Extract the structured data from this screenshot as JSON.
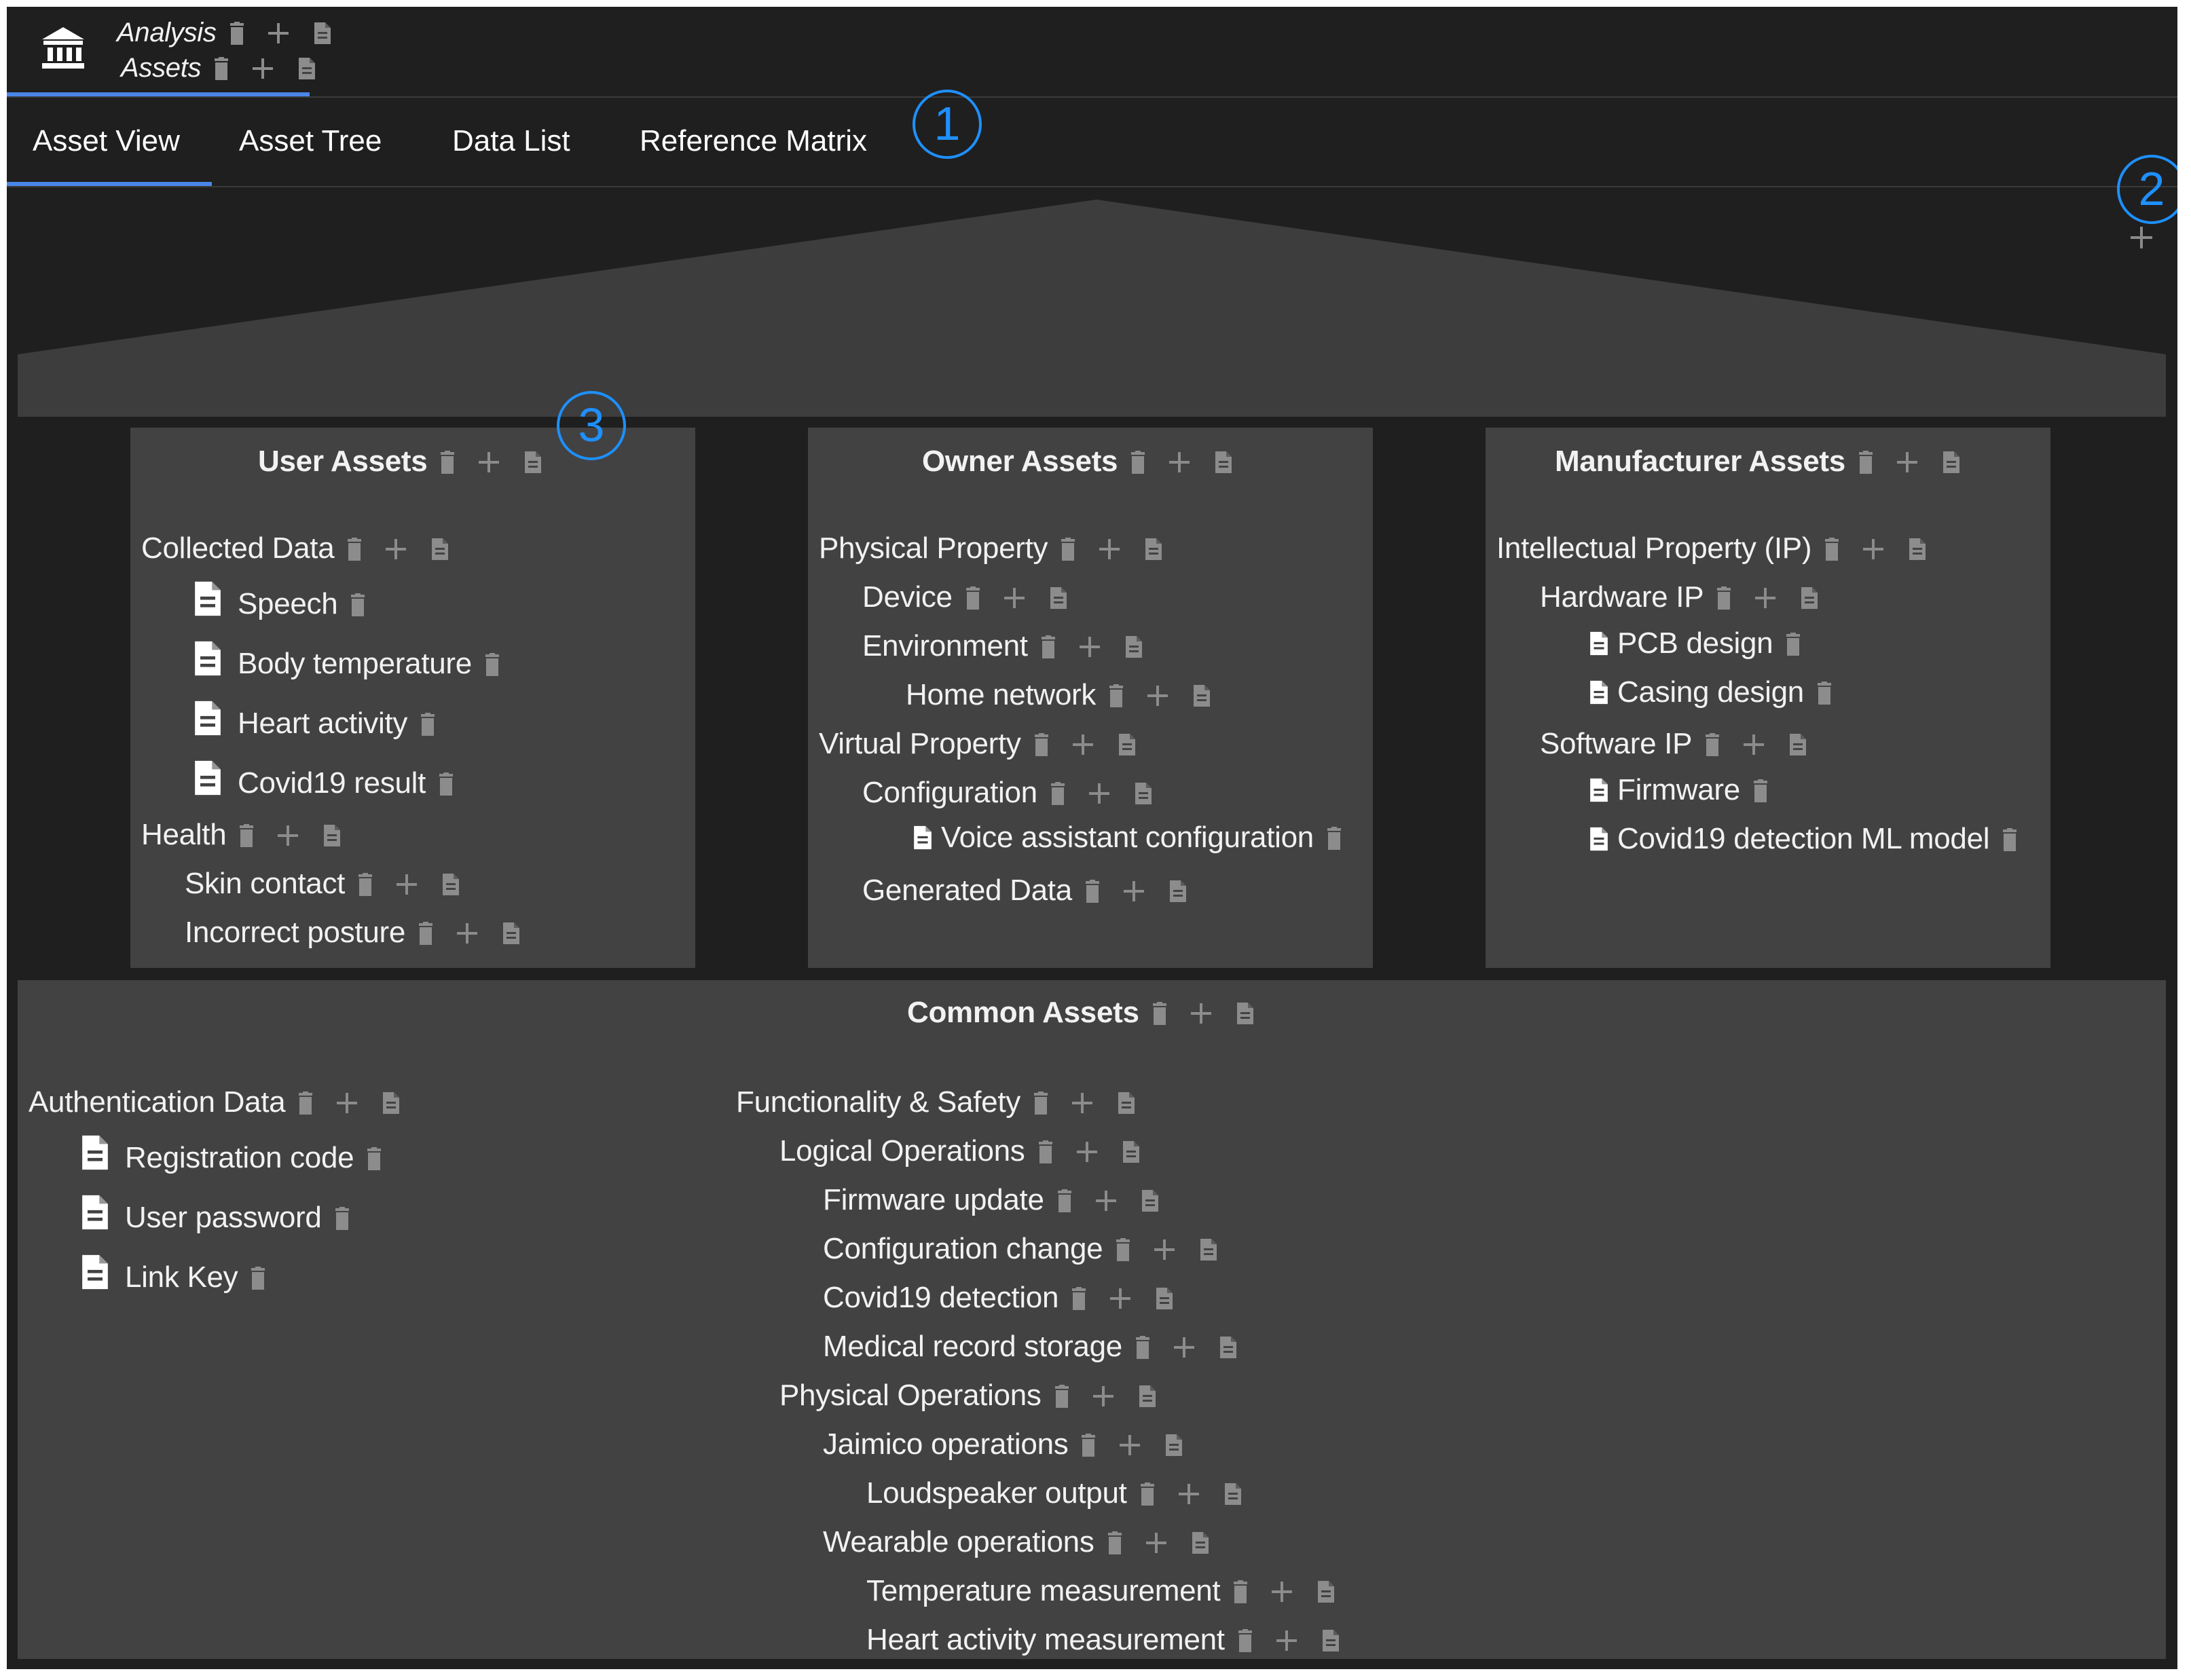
{
  "header": {
    "app_title_line1": "Analysis",
    "app_title_line2": "Assets"
  },
  "tabs": [
    {
      "label": "Asset View",
      "active": true
    },
    {
      "label": "Asset Tree"
    },
    {
      "label": "Data List"
    },
    {
      "label": "Reference Matrix"
    }
  ],
  "callouts": [
    "1",
    "2",
    "3"
  ],
  "colors": {
    "accent": "#4a86e8",
    "callout": "#1e90ff",
    "panel": "#424242",
    "background": "#1f1f1f",
    "roof": "#3d3d3d"
  },
  "user_assets": {
    "title": "User Assets",
    "items": [
      {
        "label": "Collected Data",
        "kind": "group"
      },
      {
        "label": "Speech",
        "kind": "leaf"
      },
      {
        "label": "Body temperature",
        "kind": "leaf"
      },
      {
        "label": "Heart activity",
        "kind": "leaf"
      },
      {
        "label": "Covid19 result",
        "kind": "leaf"
      },
      {
        "label": "Health",
        "kind": "group"
      },
      {
        "label": "Skin contact",
        "kind": "group"
      },
      {
        "label": "Incorrect posture",
        "kind": "group"
      }
    ]
  },
  "owner_assets": {
    "title": "Owner Assets",
    "items": [
      {
        "label": "Physical Property",
        "kind": "group"
      },
      {
        "label": "Device",
        "kind": "group"
      },
      {
        "label": "Environment",
        "kind": "group"
      },
      {
        "label": "Home network",
        "kind": "group"
      },
      {
        "label": "Virtual Property",
        "kind": "group"
      },
      {
        "label": "Configuration",
        "kind": "group"
      },
      {
        "label": "Voice assistant configuration",
        "kind": "leaf"
      },
      {
        "label": "Generated Data",
        "kind": "group"
      }
    ]
  },
  "manufacturer_assets": {
    "title": "Manufacturer Assets",
    "items": [
      {
        "label": "Intellectual Property (IP)",
        "kind": "group"
      },
      {
        "label": "Hardware IP",
        "kind": "group"
      },
      {
        "label": "PCB design",
        "kind": "leaf"
      },
      {
        "label": "Casing design",
        "kind": "leaf"
      },
      {
        "label": "Software IP",
        "kind": "group"
      },
      {
        "label": "Firmware",
        "kind": "leaf"
      },
      {
        "label": "Covid19 detection ML model",
        "kind": "leaf"
      }
    ]
  },
  "common_assets": {
    "title": "Common Assets",
    "left": [
      {
        "label": "Authentication Data",
        "kind": "group"
      },
      {
        "label": "Registration code",
        "kind": "leaf"
      },
      {
        "label": "User password",
        "kind": "leaf"
      },
      {
        "label": "Link Key",
        "kind": "leaf"
      }
    ],
    "right": [
      {
        "label": "Functionality & Safety",
        "kind": "group"
      },
      {
        "label": "Logical Operations",
        "kind": "group"
      },
      {
        "label": "Firmware update",
        "kind": "group"
      },
      {
        "label": "Configuration change",
        "kind": "group"
      },
      {
        "label": "Covid19 detection",
        "kind": "group"
      },
      {
        "label": "Medical record storage",
        "kind": "group"
      },
      {
        "label": "Physical Operations",
        "kind": "group"
      },
      {
        "label": "Jaimico operations",
        "kind": "group"
      },
      {
        "label": "Loudspeaker output",
        "kind": "group"
      },
      {
        "label": "Wearable operations",
        "kind": "group"
      },
      {
        "label": "Temperature measurement",
        "kind": "group"
      },
      {
        "label": "Heart activity measurement",
        "kind": "group"
      }
    ]
  }
}
